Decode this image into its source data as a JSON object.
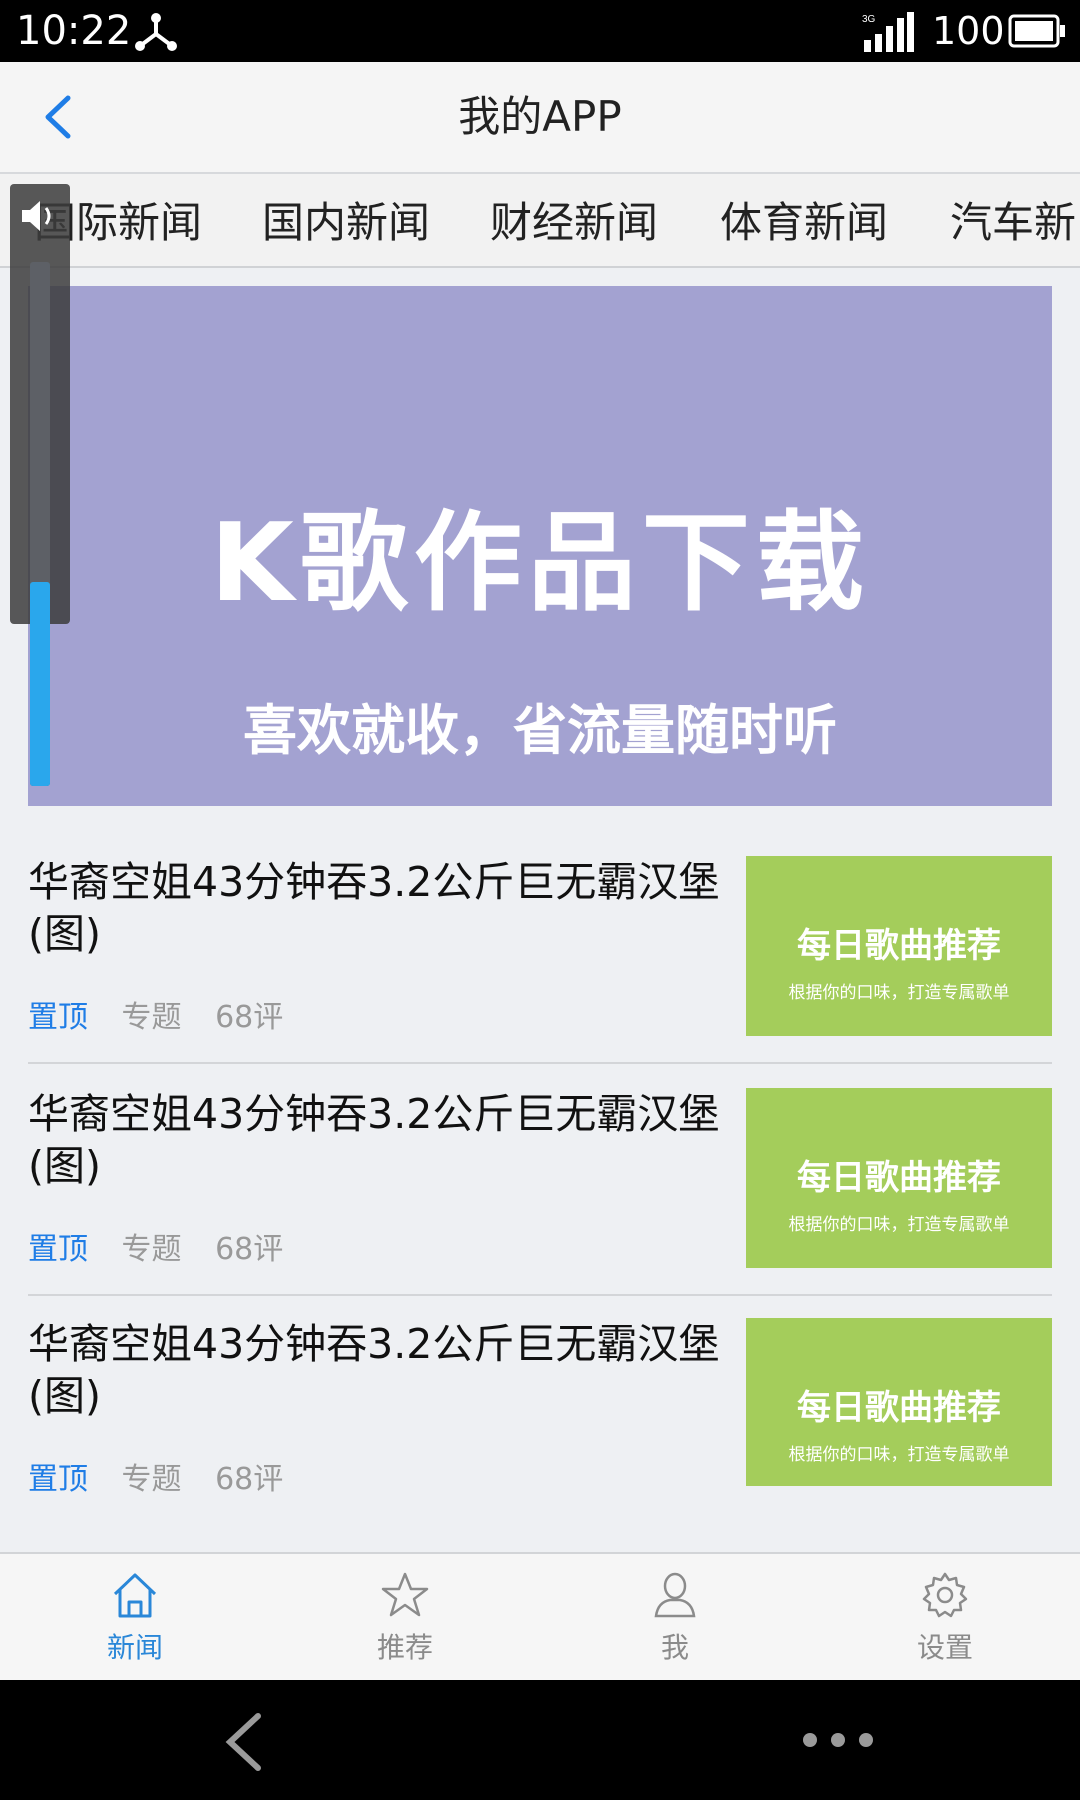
{
  "status_bar": {
    "time": "10:22",
    "network": "3G",
    "battery": "100"
  },
  "header": {
    "title": "我的APP",
    "back_icon": "chevron-left-icon"
  },
  "category_tabs": [
    "国际新闻",
    "国内新闻",
    "财经新闻",
    "体育新闻",
    "汽车新"
  ],
  "banner": {
    "title": "K歌作品下载",
    "subtitle": "喜欢就收，省流量随时听",
    "background": "#a3a2d1"
  },
  "news": [
    {
      "title": "华裔空姐43分钟吞3.2公斤巨无霸汉堡(图)",
      "pin": "置顶",
      "topic": "专题",
      "comments": "68评",
      "thumb_title": "每日歌曲推荐",
      "thumb_sub": "根据你的口味，打造专属歌单"
    },
    {
      "title": "华裔空姐43分钟吞3.2公斤巨无霸汉堡(图)",
      "pin": "置顶",
      "topic": "专题",
      "comments": "68评",
      "thumb_title": "每日歌曲推荐",
      "thumb_sub": "根据你的口味，打造专属歌单"
    },
    {
      "title": "华裔空姐43分钟吞3.2公斤巨无霸汉堡(图)",
      "pin": "置顶",
      "topic": "专题",
      "comments": "68评",
      "thumb_title": "每日歌曲推荐",
      "thumb_sub": "根据你的口味，打造专属歌单"
    }
  ],
  "bottom_nav": [
    {
      "label": "新闻",
      "icon": "home-icon",
      "active": true
    },
    {
      "label": "推荐",
      "icon": "star-icon",
      "active": false
    },
    {
      "label": "我",
      "icon": "person-icon",
      "active": false
    },
    {
      "label": "设置",
      "icon": "gear-icon",
      "active": false
    }
  ],
  "volume_level": 0.39,
  "colors": {
    "accent": "#2a87d8",
    "pin": "#1f7de6",
    "thumb": "#a4cd5b",
    "volume": "#2aa7ec"
  }
}
